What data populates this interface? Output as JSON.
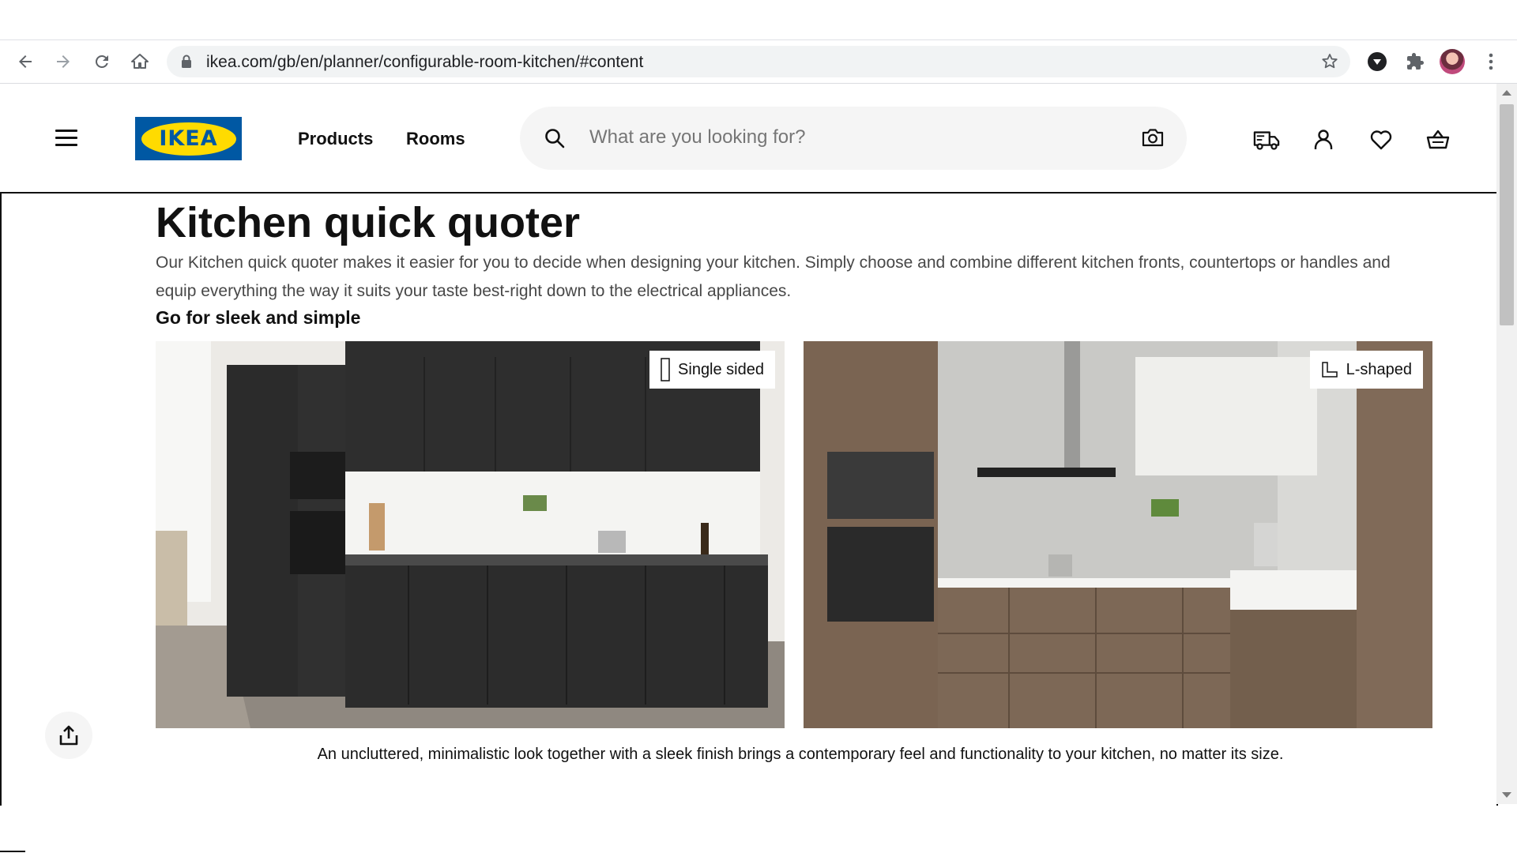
{
  "browser": {
    "url": "ikea.com/gb/en/planner/configurable-room-kitchen/#content"
  },
  "header": {
    "logo_text": "IKEA",
    "nav": [
      "Products",
      "Rooms"
    ],
    "search_placeholder": "What are you looking for?",
    "icons": [
      "truck-icon",
      "user-icon",
      "heart-icon",
      "basket-icon"
    ]
  },
  "main": {
    "title": "Kitchen quick quoter",
    "description": "Our Kitchen quick quoter makes it easier for you to decide when designing your kitchen. Simply choose and combine different kitchen fronts, countertops or handles and equip everything the way it suits your taste best-right down to the electrical appliances.",
    "subheading": "Go for sleek and simple",
    "cards": [
      {
        "label": "Single sided"
      },
      {
        "label": "L-shaped"
      }
    ],
    "caption": "An uncluttered, minimalistic look together with a sleek finish brings a contemporary feel and functionality to your kitchen, no matter its size."
  },
  "colors": {
    "ikea_blue": "#0058a3",
    "ikea_yellow": "#ffdb00",
    "text": "#111111"
  }
}
